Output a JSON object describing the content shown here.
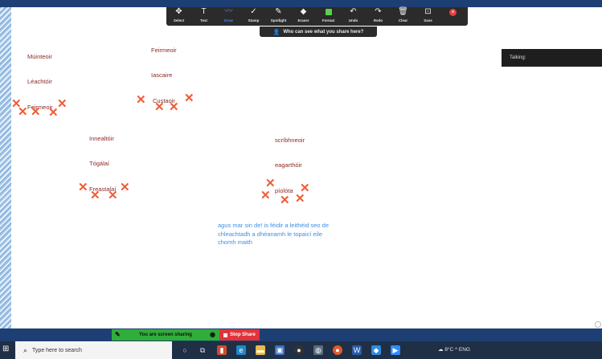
{
  "toolbar": {
    "tools": [
      {
        "label": "Select",
        "icon": "✥"
      },
      {
        "label": "Text",
        "icon": "T"
      },
      {
        "label": "Draw",
        "icon": "〰"
      },
      {
        "label": "Stamp",
        "icon": "✓"
      },
      {
        "label": "Spotlight",
        "icon": "✎"
      },
      {
        "label": "Eraser",
        "icon": "◆"
      },
      {
        "label": "Format",
        "icon": ""
      },
      {
        "label": "Undo",
        "icon": "↶"
      },
      {
        "label": "Redo",
        "icon": "↷"
      },
      {
        "label": "Clear",
        "icon": "🗑"
      },
      {
        "label": "Save",
        "icon": "⊡"
      }
    ]
  },
  "banner": {
    "who_can_see": "Who can see what you share here?"
  },
  "talking": {
    "label": "Talking:"
  },
  "words": {
    "muinteoir": "Múinteoir",
    "leachtoir": "Léachtóir",
    "feirmeoir_left": "Feirmeoir",
    "feirmeoir_top": "Feirmeoir",
    "iascaire": "Iascaire",
    "custaoir": "Custaoir",
    "innealtoir": "Innealtóir",
    "togalai": "Tógálaí",
    "freastalai": "Freastalaí",
    "scribhneoir": "scríbhneoir",
    "eagarthoir": "eagarthóir",
    "piolota": "píolóta"
  },
  "note": {
    "line1": "agus mar sin de! is féidir a leithéid seo de",
    "line2": "chleachtadh a dhéanamh le topaicí eile",
    "line3": "chomh maith"
  },
  "share": {
    "status": "You are screen sharing",
    "stop": "Stop Share"
  },
  "taskbar": {
    "search_placeholder": "Type here to search",
    "tray_text": "8°C  ^  ENG"
  },
  "colors": {
    "annotation_red": "#f05b36",
    "word_red": "#8a2a24",
    "note_blue": "#3d8fe6",
    "share_green": "#2fae3a",
    "stop_red": "#e2333a"
  }
}
